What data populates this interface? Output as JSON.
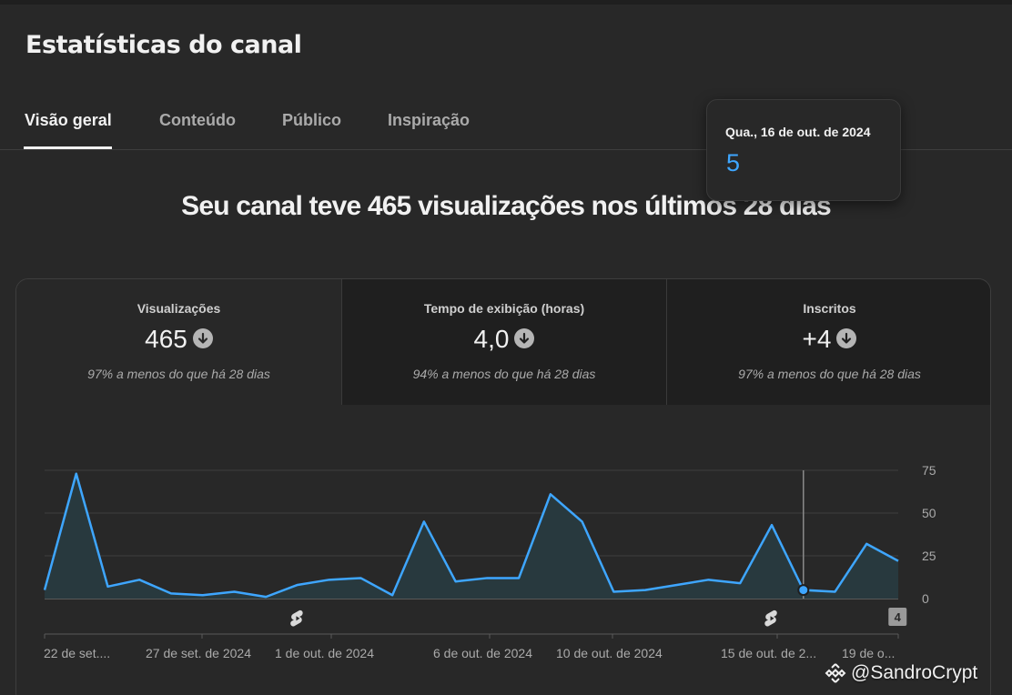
{
  "page": {
    "title": "Estatísticas do canal"
  },
  "tabs": [
    {
      "label": "Visão geral"
    },
    {
      "label": "Conteúdo"
    },
    {
      "label": "Público"
    },
    {
      "label": "Inspiração"
    }
  ],
  "headline": "Seu canal teve 465 visualizações nos últimos 28 dias",
  "tooltip": {
    "date": "Qua., 16 de out. de 2024",
    "value": "5"
  },
  "metrics": [
    {
      "label": "Visualizações",
      "value": "465",
      "trend_icon": "arrow-down-circle-icon",
      "comparison": "97% a menos do que há 28 dias"
    },
    {
      "label": "Tempo de exibição (horas)",
      "value": "4,0",
      "trend_icon": "arrow-down-circle-icon",
      "comparison": "94% a menos do que há 28 dias"
    },
    {
      "label": "Inscritos",
      "value": "+4",
      "trend_icon": "arrow-down-circle-icon",
      "comparison": "97% a menos do que há 28 dias"
    }
  ],
  "chart_data": {
    "type": "area",
    "series": [
      {
        "values": [
          5,
          73,
          7,
          11,
          3,
          2,
          4,
          1,
          8,
          11,
          12,
          2,
          45,
          10,
          12,
          12,
          61,
          45,
          4,
          5,
          8,
          11,
          9,
          43,
          5,
          4,
          32,
          22
        ]
      }
    ],
    "ylim": [
      0,
      75
    ],
    "yticks": [
      "0",
      "25",
      "50",
      "75"
    ],
    "xticks": [
      "22 de set....",
      "27 de set. de 2024",
      "1 de out. de 2024",
      "6 de out. de 2024",
      "10 de out. de 2024",
      "15 de out. de 2...",
      "19 de o..."
    ],
    "highlight_index": 24,
    "markers": [
      {
        "index": 8,
        "icon": "shorts-icon"
      },
      {
        "index": 23,
        "icon": "shorts-icon"
      },
      {
        "index": 26,
        "label": "4"
      }
    ],
    "colors": {
      "line": "#3ea6ff",
      "fill": "#28393e",
      "grid": "#3e3e3e",
      "tick": "#aaaaaa"
    }
  },
  "watermark": {
    "text": "@SandroCrypt",
    "icon": "binance-logo-icon"
  }
}
